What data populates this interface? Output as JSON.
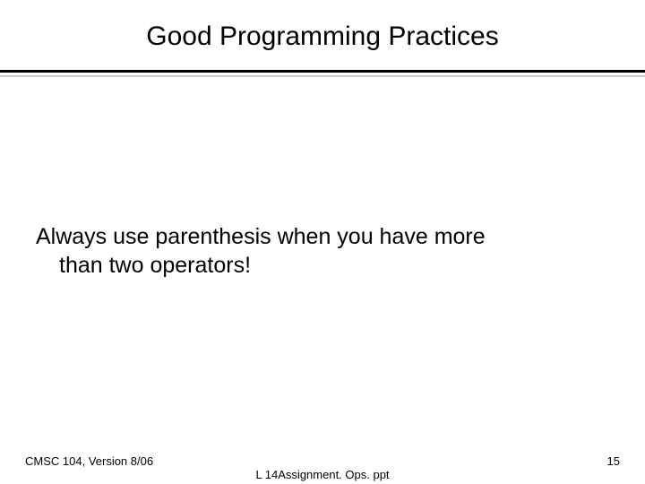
{
  "title": "Good Programming Practices",
  "body_line1": "Always use parenthesis when you have more",
  "body_line2": "than two operators!",
  "footer": {
    "left": "CMSC 104, Version 8/06",
    "center": "L 14Assignment. Ops. ppt",
    "right": "15"
  }
}
